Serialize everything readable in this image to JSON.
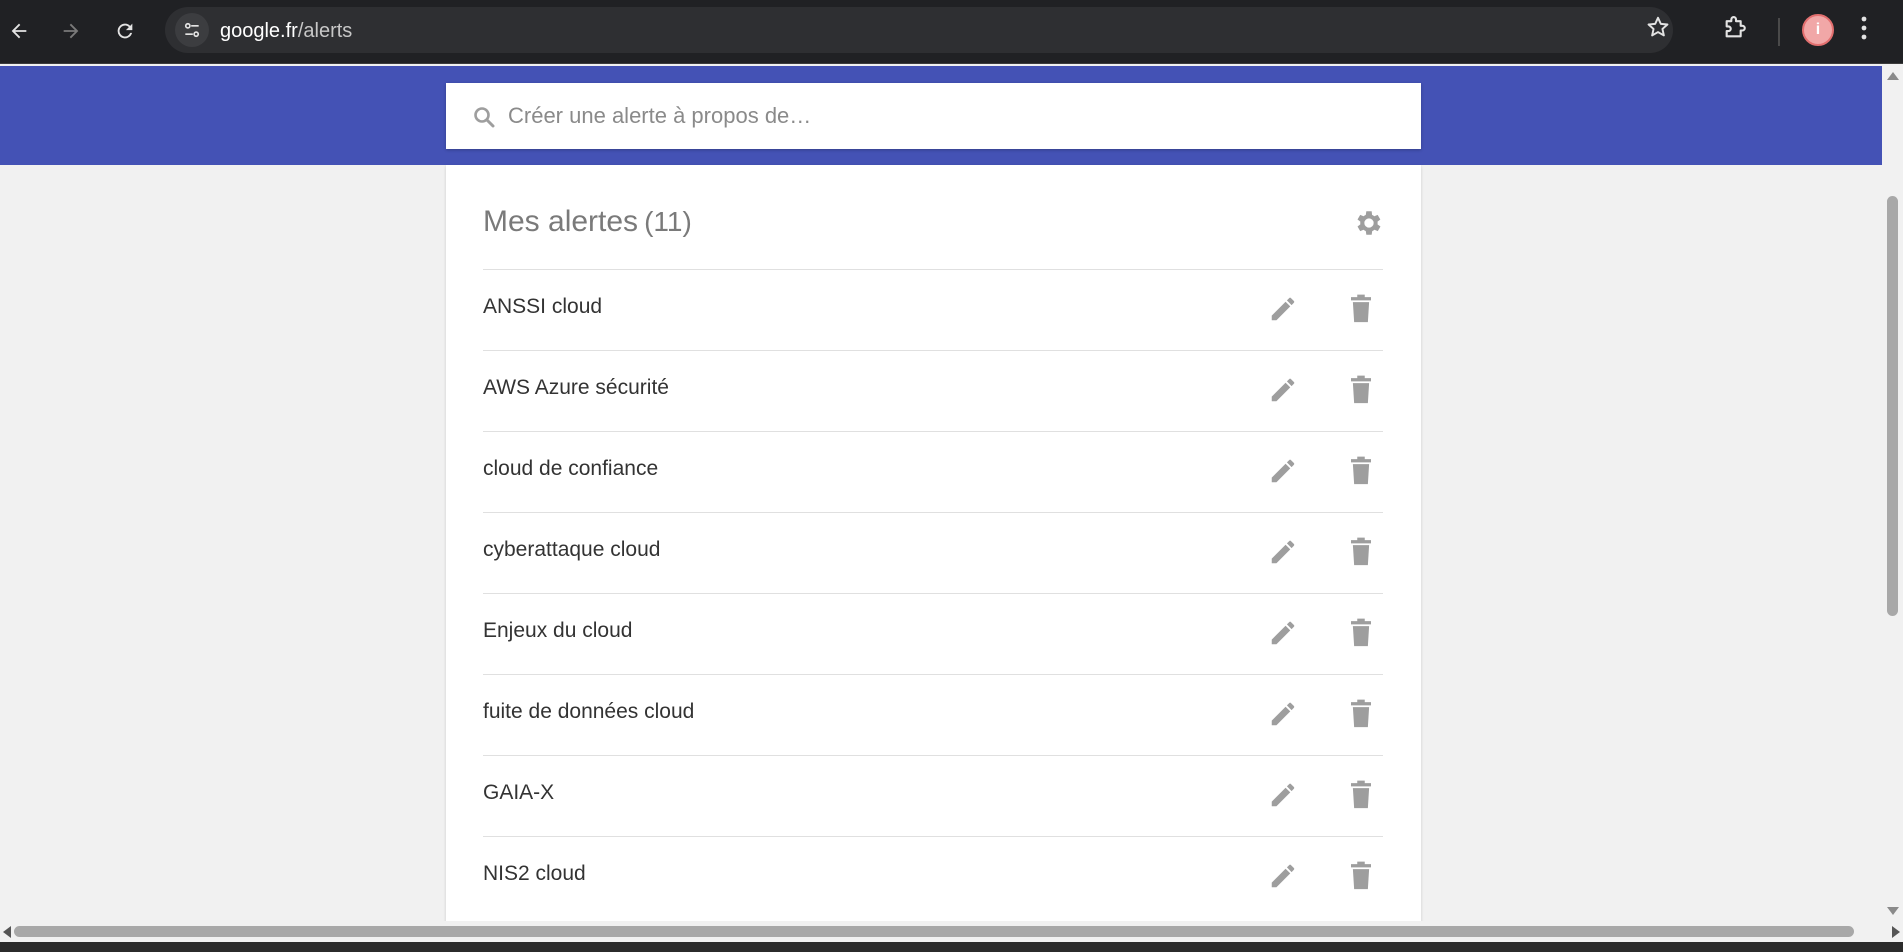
{
  "browser": {
    "url_host": "google.fr",
    "url_path": "/alerts",
    "profile_initial": "i"
  },
  "search": {
    "placeholder": "Créer une alerte à propos de…"
  },
  "alerts": {
    "title": "Mes alertes",
    "count": "(11)",
    "items": [
      {
        "label": "ANSSI cloud"
      },
      {
        "label": "AWS Azure sécurité"
      },
      {
        "label": "cloud de confiance"
      },
      {
        "label": "cyberattaque cloud"
      },
      {
        "label": "Enjeux du cloud"
      },
      {
        "label": "fuite de données cloud"
      },
      {
        "label": "GAIA-X"
      },
      {
        "label": "NIS2 cloud"
      }
    ]
  },
  "colors": {
    "header_band": "#4452b5",
    "browser_bg": "#202124",
    "page_bg": "#f1f1f1",
    "icon_gray": "#9e9e9e"
  },
  "icons": {
    "back": "arrow-left-icon",
    "forward": "arrow-right-icon",
    "reload": "reload-icon",
    "site_info": "tune-icon",
    "bookmark": "star-icon",
    "extensions": "puzzle-icon",
    "menu": "kebab-icon",
    "search": "search-icon",
    "settings": "gear-icon",
    "edit": "pencil-icon",
    "delete": "trash-icon"
  }
}
